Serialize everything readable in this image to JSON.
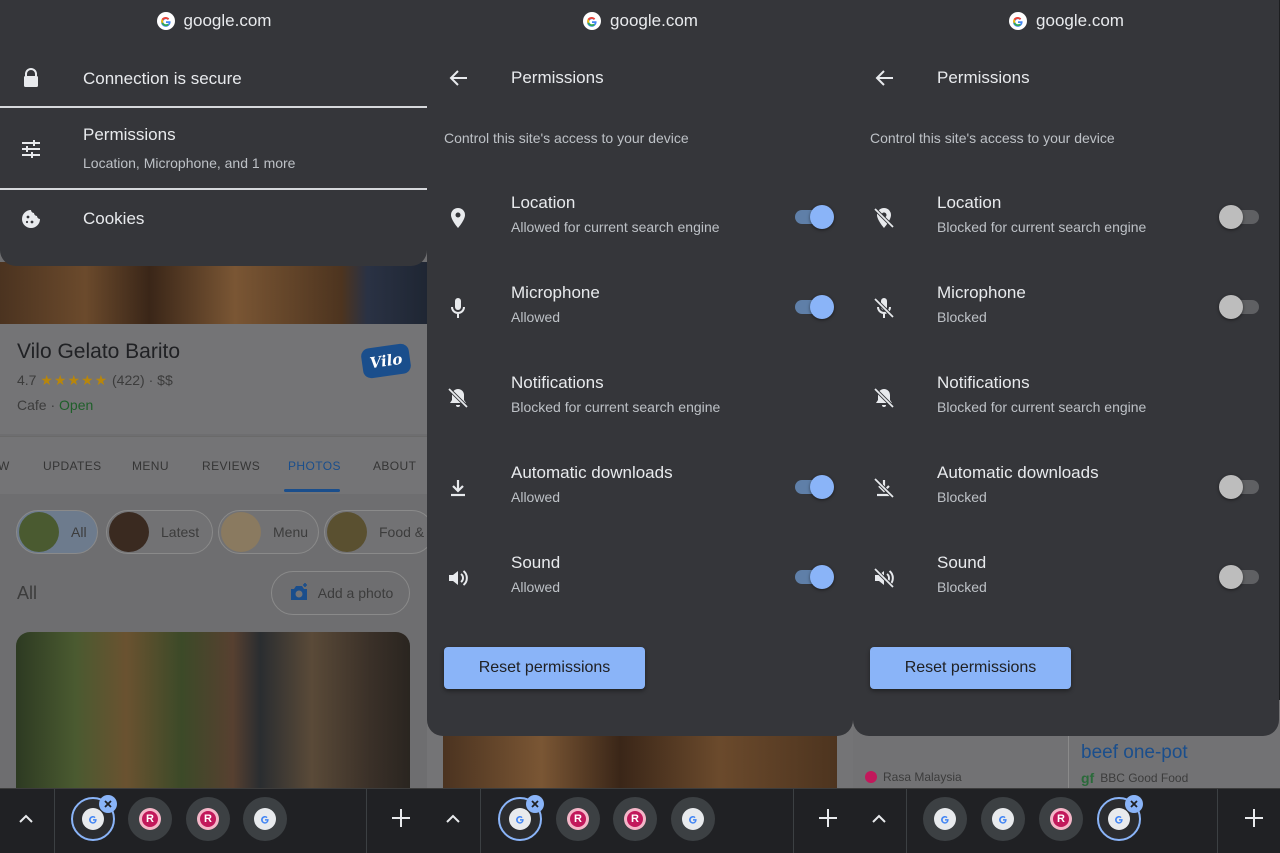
{
  "site_url": "google.com",
  "panel1": {
    "connection_label": "Connection is secure",
    "permissions_label": "Permissions",
    "permissions_sub": "Location, Microphone, and 1 more",
    "cookies_label": "Cookies"
  },
  "background_page": {
    "place_name": "Vilo Gelato Barito",
    "rating": "4.7",
    "stars": "★★★★★",
    "reviews": "(422)",
    "price": "$$",
    "category": "Cafe",
    "status": "Open",
    "logo_text": "Vilo",
    "tabs": [
      "W",
      "UPDATES",
      "MENU",
      "REVIEWS",
      "PHOTOS",
      "ABOUT"
    ],
    "active_tab": "PHOTOS",
    "chips": [
      "All",
      "Latest",
      "Menu",
      "Food &"
    ],
    "section_label": "All",
    "add_photo": "Add a photo"
  },
  "permissions_header": {
    "title": "Permissions",
    "description": "Control this site's access to your device"
  },
  "panel2": {
    "permissions": [
      {
        "name": "Location",
        "status": "Allowed for current search engine",
        "icon": "location-icon",
        "toggle": "on"
      },
      {
        "name": "Microphone",
        "status": "Allowed",
        "icon": "microphone-icon",
        "toggle": "on"
      },
      {
        "name": "Notifications",
        "status": "Blocked for current search engine",
        "icon": "notifications-off-icon",
        "toggle": "none"
      },
      {
        "name": "Automatic downloads",
        "status": "Allowed",
        "icon": "download-icon",
        "toggle": "on"
      },
      {
        "name": "Sound",
        "status": "Allowed",
        "icon": "sound-icon",
        "toggle": "on"
      }
    ],
    "reset_label": "Reset permissions"
  },
  "panel3": {
    "permissions": [
      {
        "name": "Location",
        "status": "Blocked for current search engine",
        "icon": "location-off-icon",
        "toggle": "off"
      },
      {
        "name": "Microphone",
        "status": "Blocked",
        "icon": "microphone-off-icon",
        "toggle": "off"
      },
      {
        "name": "Notifications",
        "status": "Blocked for current search engine",
        "icon": "notifications-off-icon",
        "toggle": "none"
      },
      {
        "name": "Automatic downloads",
        "status": "Blocked",
        "icon": "download-off-icon",
        "toggle": "off"
      },
      {
        "name": "Sound",
        "status": "Blocked",
        "icon": "sound-off-icon",
        "toggle": "off"
      }
    ],
    "reset_label": "Reset permissions",
    "bg_headline": "beef one-pot",
    "bg_source1": "Rasa Malaysia",
    "bg_source2": "BBC Good Food",
    "bg_source2_logo": "gf"
  },
  "tab_icons": {
    "r_letter": "R"
  },
  "colors": {
    "sheet_bg": "#35363a",
    "accent": "#8ab4f8",
    "toggle_on_track": "#5f7fa8",
    "toggle_off_knob": "#bdbdbd",
    "bottom_bar": "#202124"
  }
}
